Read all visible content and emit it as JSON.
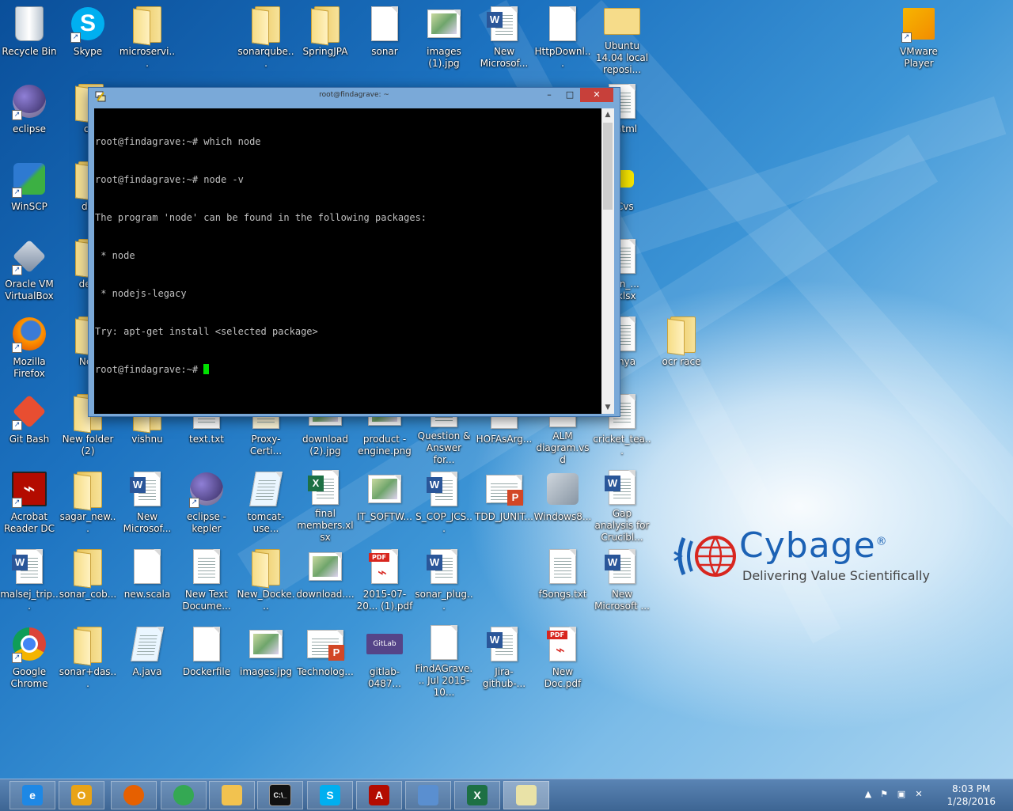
{
  "desktop_icons": [
    {
      "label": "Recycle Bin",
      "icon": "recycle-bin-icon"
    },
    {
      "label": "Skype",
      "icon": "skype-icon"
    },
    {
      "label": "microservi...",
      "icon": "folder-icon"
    },
    {
      "label": "sonarqube...",
      "icon": "folder-icon"
    },
    {
      "label": "SpringJPA",
      "icon": "folder-icon"
    },
    {
      "label": "sonar",
      "icon": "file-icon"
    },
    {
      "label": "images (1).jpg",
      "icon": "image-file-icon"
    },
    {
      "label": "New Microsof...",
      "icon": "word-doc-icon"
    },
    {
      "label": "HttpDownl...",
      "icon": "file-icon"
    },
    {
      "label": "Ubuntu 14.04 local reposi...",
      "icon": "envelope-icon"
    },
    {
      "label": "VMware Player",
      "icon": "vmware-icon"
    },
    {
      "label": "eclipse",
      "icon": "eclipse-icon"
    },
    {
      "label": "cu",
      "icon": "folder-icon"
    },
    {
      "label": "o.html",
      "icon": "document-icon"
    },
    {
      "label": "WinSCP",
      "icon": "winscp-icon"
    },
    {
      "label": "der",
      "icon": "folder-icon"
    },
    {
      "label": "nCvs",
      "icon": "tortoise-cvs-icon"
    },
    {
      "label": "Oracle VM VirtualBox",
      "icon": "virtualbox-icon"
    },
    {
      "label": "dem",
      "icon": "folder-icon"
    },
    {
      "label": "ition_... n.xlsx",
      "icon": "spreadsheet-icon"
    },
    {
      "label": "Mozilla Firefox",
      "icon": "firefox-icon"
    },
    {
      "label": "New",
      "icon": "folder-icon"
    },
    {
      "label": "tanya",
      "icon": "document-icon"
    },
    {
      "label": "ocr race",
      "icon": "folder-icon"
    },
    {
      "label": "Git Bash",
      "icon": "git-bash-icon"
    },
    {
      "label": "New folder (2)",
      "icon": "folder-icon"
    },
    {
      "label": "vishnu",
      "icon": "folder-icon"
    },
    {
      "label": "text.txt",
      "icon": "text-file-icon"
    },
    {
      "label": "Proxy-Certi...",
      "icon": "certificate-icon"
    },
    {
      "label": "download (2).jpg",
      "icon": "image-file-icon"
    },
    {
      "label": "product - engine.png",
      "icon": "image-file-icon"
    },
    {
      "label": "Question & Answer for...",
      "icon": "word-doc-icon"
    },
    {
      "label": "HOFAsArg...",
      "icon": "file-icon"
    },
    {
      "label": "ALM diagram.vsd",
      "icon": "file-icon"
    },
    {
      "label": "cricket_tea...",
      "icon": "document-icon"
    },
    {
      "label": "Acrobat Reader DC",
      "icon": "acrobat-icon"
    },
    {
      "label": "sagar_new...",
      "icon": "folder-icon"
    },
    {
      "label": "New Microsof...",
      "icon": "word-doc-icon"
    },
    {
      "label": "eclipse - kepler",
      "icon": "eclipse-icon"
    },
    {
      "label": "tomcat-use...",
      "icon": "notepad-icon"
    },
    {
      "label": "final members.xlsx",
      "icon": "excel-icon"
    },
    {
      "label": "IT_SOFTW...",
      "icon": "image-file-icon"
    },
    {
      "label": "S_COP_JCS...",
      "icon": "word-doc-icon"
    },
    {
      "label": "TDD_JUNIT...",
      "icon": "powerpoint-icon"
    },
    {
      "label": "Windows8...",
      "icon": "installer-icon"
    },
    {
      "label": "Gap analysis for Crucibl...",
      "icon": "word-doc-icon"
    },
    {
      "label": "malsej_trip...",
      "icon": "word-doc-icon"
    },
    {
      "label": "sonar_cob...",
      "icon": "folder-icon"
    },
    {
      "label": "new.scala",
      "icon": "file-icon"
    },
    {
      "label": "New Text Docume...",
      "icon": "text-file-icon"
    },
    {
      "label": "New_Docke...",
      "icon": "zip-folder-icon"
    },
    {
      "label": "download....",
      "icon": "image-file-icon"
    },
    {
      "label": "2015-07-20... (1).pdf",
      "icon": "pdf-icon"
    },
    {
      "label": "sonar_plug...",
      "icon": "word-doc-icon"
    },
    {
      "label": "fSongs.txt",
      "icon": "text-file-icon"
    },
    {
      "label": "New Microsoft ...",
      "icon": "word-doc-icon"
    },
    {
      "label": "Google Chrome",
      "icon": "chrome-icon"
    },
    {
      "label": "sonar+das...",
      "icon": "folder-icon"
    },
    {
      "label": "A.java",
      "icon": "notepad-icon"
    },
    {
      "label": "Dockerfile",
      "icon": "file-icon"
    },
    {
      "label": "images.jpg",
      "icon": "image-file-icon"
    },
    {
      "label": "Technolog...",
      "icon": "powerpoint-icon"
    },
    {
      "label": "gitlab-0487...",
      "icon": "gitlab-image-icon"
    },
    {
      "label": "FindAGrave... Jul 2015- 10...",
      "icon": "file-icon"
    },
    {
      "label": "Jira-github-...",
      "icon": "word-doc-icon"
    },
    {
      "label": "New Doc.pdf",
      "icon": "pdf-icon"
    }
  ],
  "terminal": {
    "title": "root@findagrave: ~",
    "lines": [
      "root@findagrave:~# which node",
      "root@findagrave:~# node -v",
      "The program 'node' can be found in the following packages:",
      " * node",
      " * nodejs-legacy",
      "Try: apt-get install <selected package>",
      "root@findagrave:~# "
    ],
    "min_glyph": "–",
    "max_glyph": "□",
    "close_glyph": "✕"
  },
  "logo": {
    "name": "Cybage",
    "registered": "®",
    "tagline": "Delivering Value Scientifically"
  },
  "taskbar": {
    "apps": [
      {
        "name": "internet-explorer",
        "glyph": "e",
        "color": "#1e88e5"
      },
      {
        "name": "outlook",
        "glyph": "O",
        "color": "#e8a317"
      },
      {
        "name": "firefox",
        "glyph": "",
        "color": "#e66000"
      },
      {
        "name": "chrome",
        "glyph": "",
        "color": "#34a853"
      },
      {
        "name": "file-explorer",
        "glyph": "",
        "color": "#f2c24f"
      },
      {
        "name": "command-prompt",
        "glyph": "C:\\_",
        "color": "#111111"
      },
      {
        "name": "skype",
        "glyph": "S",
        "color": "#00aff0"
      },
      {
        "name": "acrobat",
        "glyph": "A",
        "color": "#b30b00"
      },
      {
        "name": "control-panel",
        "glyph": "",
        "color": "#5a8fd0"
      },
      {
        "name": "excel",
        "glyph": "X",
        "color": "#1d7044"
      },
      {
        "name": "putty",
        "glyph": "",
        "color": "#e9e2a7"
      }
    ],
    "time": "8:03 PM",
    "date": "1/28/2016"
  },
  "colors": {
    "terminal_cursor": "#00e000",
    "logo_blue": "#1c62b5",
    "logo_red": "#d8261f"
  }
}
